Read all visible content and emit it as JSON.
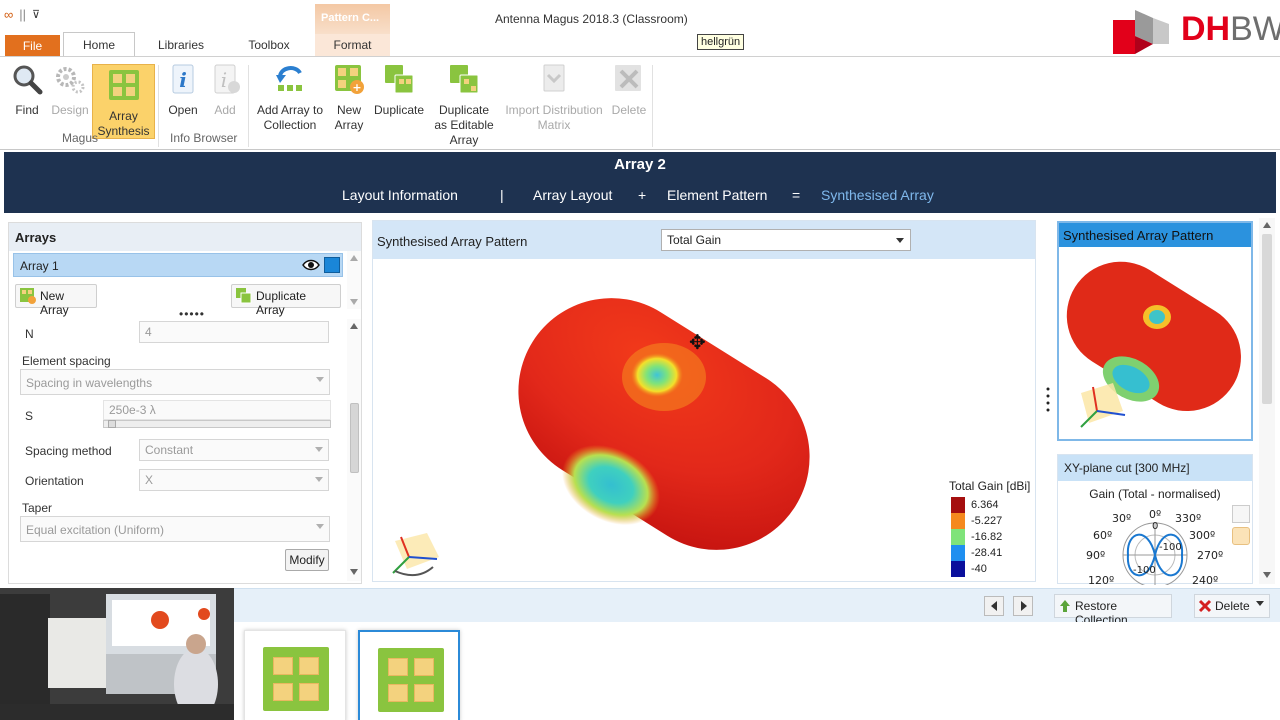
{
  "window": {
    "title": "Antenna Magus 2018.3 (Classroom)",
    "contextual_tab_group": "Pattern C..."
  },
  "logo": {
    "text_dh": "DH",
    "text_bw": "BW"
  },
  "ribbon_tabs": {
    "file": "File",
    "home": "Home",
    "libraries": "Libraries",
    "toolbox": "Toolbox",
    "format": "Format"
  },
  "ribbon": {
    "find": "Find",
    "design": "Design",
    "array_synthesis_l1": "Array",
    "array_synthesis_l2": "Synthesis",
    "open": "Open",
    "add": "Add",
    "add_to_collection_l1": "Add Array to",
    "add_to_collection_l2": "Collection",
    "new_array_l1": "New",
    "new_array_l2": "Array",
    "duplicate": "Duplicate",
    "dup_editable_l1": "Duplicate",
    "dup_editable_l2": "as Editable",
    "dup_editable_l3": "Array",
    "import_l1": "Import Distribution",
    "import_l2": "Matrix",
    "delete": "Delete",
    "group_magus": "Magus",
    "group_info_browser": "Info Browser"
  },
  "tooltip": "hellgrün",
  "nav": {
    "title": "Array 2",
    "layout_info": "Layout Information",
    "sep_bar": "|",
    "array_layout": "Array Layout",
    "plus": "+",
    "element_pattern": "Element Pattern",
    "equals": "=",
    "synthesised_array": "Synthesised Array"
  },
  "left": {
    "header": "Arrays",
    "array_item": "Array 1",
    "new_array_button": "New Array",
    "duplicate_array_button": "Duplicate Array",
    "grip": "•••••",
    "n_label": "N",
    "n_value": "4",
    "element_spacing_label": "Element spacing",
    "element_spacing_value": "Spacing in wavelengths",
    "s_label": "S",
    "s_value": "250e-3 λ",
    "spacing_method_label": "Spacing method",
    "spacing_method_value": "Constant",
    "orientation_label": "Orientation",
    "orientation_value": "X",
    "taper_label": "Taper",
    "taper_value": "Equal excitation (Uniform)",
    "modify_button": "Modify"
  },
  "center": {
    "header": "Synthesised Array Pattern",
    "quantity_select": "Total Gain",
    "legend_title": "Total Gain [dBi]",
    "legend": [
      {
        "value": "6.364",
        "color": "#a50f0f"
      },
      {
        "value": "-5.227",
        "color": "#f5891e"
      },
      {
        "value": "-16.82",
        "color": "#7fe37a"
      },
      {
        "value": "-28.41",
        "color": "#1f8ff0"
      },
      {
        "value": "-40",
        "color": "#0a0f9c"
      }
    ]
  },
  "right": {
    "thumb_title": "Synthesised Array Pattern",
    "cut_title": "XY-plane cut [300 MHz]",
    "cut_subtitle": "Gain (Total - normalised)",
    "polar_labels": {
      "a0": "0º",
      "a30": "30º",
      "a60": "60º",
      "a90": "90º",
      "a120": "120º",
      "a240": "240º",
      "a270": "270º",
      "a300": "300º",
      "a330": "330º",
      "r0": "0",
      "rm100a": "-100",
      "rm100b": "-100"
    }
  },
  "bottom": {
    "restore_collection": "Restore Collection",
    "delete": "Delete"
  },
  "colors": {
    "navy": "#1e3250",
    "accent_blue": "#2b92de",
    "file_orange": "#e2701e",
    "highlight": "#fbd26a",
    "dhbw_red": "#e2001a"
  }
}
